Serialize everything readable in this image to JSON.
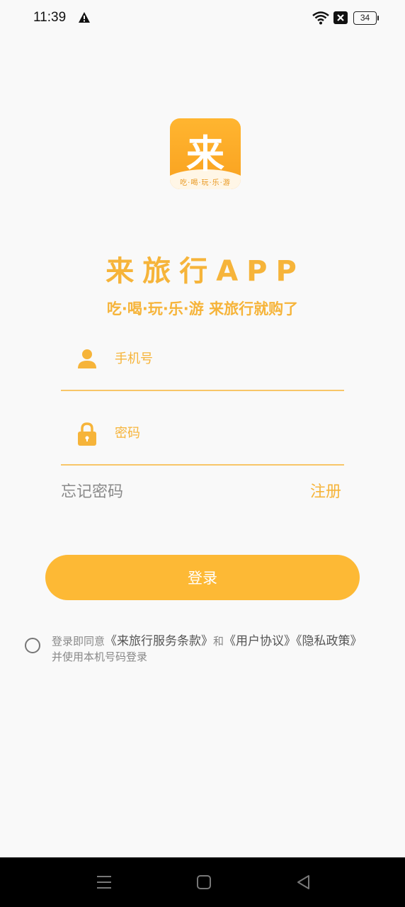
{
  "status_bar": {
    "time": "11:39",
    "battery": "34",
    "icons": [
      "warning-icon",
      "wifi-icon",
      "x-box-icon",
      "battery-icon"
    ]
  },
  "logo": {
    "char": "来",
    "tagline": "吃·喝·玩·乐·游"
  },
  "app_title": "来旅行APP",
  "app_slogan": "吃·喝·玩·乐·游 来旅行就购了",
  "form": {
    "phone_placeholder": "手机号",
    "password_placeholder": "密码",
    "forgot_label": "忘记密码",
    "register_label": "注册",
    "login_label": "登录"
  },
  "agreement": {
    "prefix": "登录即同意",
    "terms": "《来旅行服务条款》",
    "and": "和",
    "user_agreement": "《用户协议》",
    "privacy": "《隐私政策》",
    "line2": "并使用本机号码登录"
  },
  "nav_bar": {
    "icons": [
      "menu-icon",
      "home-icon",
      "back-icon"
    ]
  },
  "colors": {
    "accent": "#f6b43a",
    "button": "#fdb935",
    "background": "#f9f9f9"
  }
}
